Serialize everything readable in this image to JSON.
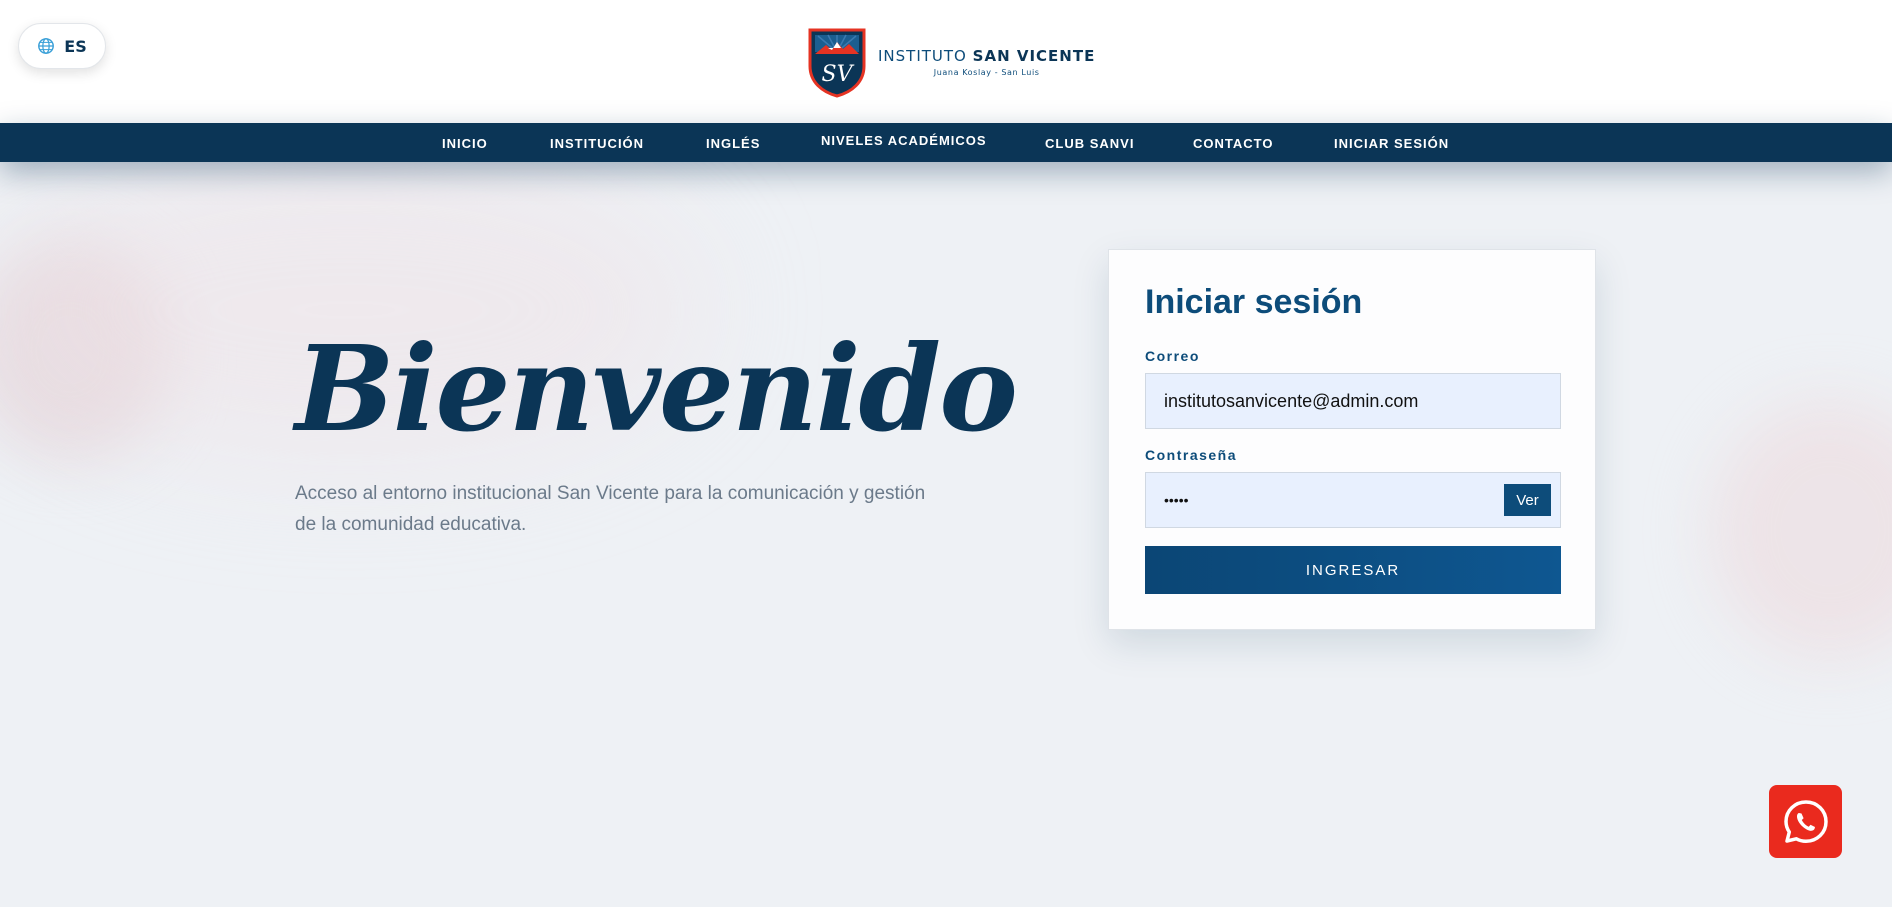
{
  "header": {
    "language": {
      "code": "ES",
      "icon": "globe-icon"
    },
    "logo": {
      "monogram": "SV",
      "name_light": "INSTITUTO",
      "name_bold": "SAN VICENTE",
      "subtitle": "Juana Koslay - San Luis"
    }
  },
  "nav": {
    "items": [
      {
        "label": "INICIO"
      },
      {
        "label": "INSTITUCIÓN"
      },
      {
        "label": "INGLÉS"
      },
      {
        "label": "NIVELES ACADÉMICOS"
      },
      {
        "label": "CLUB SANVI"
      },
      {
        "label": "CONTACTO"
      },
      {
        "label": "INICIAR SESIÓN"
      }
    ]
  },
  "hero": {
    "title": "Bienvenido",
    "description": "Acceso al entorno institucional San Vicente para la comunicación y gestión de la comunidad educativa."
  },
  "login": {
    "title": "Iniciar sesión",
    "email_label": "Correo",
    "email_value": "institutosanvicente@admin.com",
    "password_label": "Contraseña",
    "password_masked": "•••••",
    "show_button": "Ver",
    "submit_label": "INGRESAR"
  },
  "floating": {
    "whatsapp_icon": "whatsapp-icon"
  },
  "colors": {
    "navy": "#0b3556",
    "brand_blue": "#0d4c7a",
    "whatsapp_red": "#ea2a1e",
    "input_bg": "#e8f0fe"
  }
}
